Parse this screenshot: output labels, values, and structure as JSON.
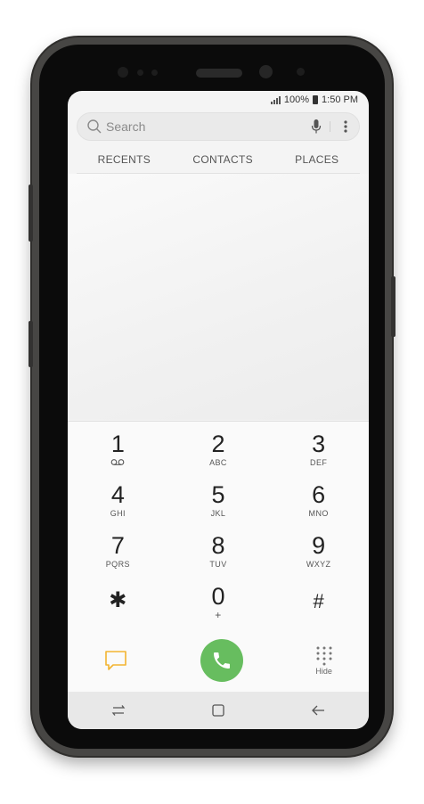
{
  "status_bar": {
    "battery": "100%",
    "time": "1:50 PM"
  },
  "search": {
    "placeholder": "Search"
  },
  "tabs": [
    {
      "label": "RECENTS"
    },
    {
      "label": "CONTACTS"
    },
    {
      "label": "PLACES"
    }
  ],
  "dialpad": {
    "keys": [
      {
        "digit": "1",
        "letters": ""
      },
      {
        "digit": "2",
        "letters": "ABC"
      },
      {
        "digit": "3",
        "letters": "DEF"
      },
      {
        "digit": "4",
        "letters": "GHI"
      },
      {
        "digit": "5",
        "letters": "JKL"
      },
      {
        "digit": "6",
        "letters": "MNO"
      },
      {
        "digit": "7",
        "letters": "PQRS"
      },
      {
        "digit": "8",
        "letters": "TUV"
      },
      {
        "digit": "9",
        "letters": "WXYZ"
      },
      {
        "digit": "✱",
        "letters": ""
      },
      {
        "digit": "0",
        "letters": "+"
      },
      {
        "digit": "#",
        "letters": ""
      }
    ],
    "hide_label": "Hide"
  },
  "colors": {
    "call_button": "#67bd5f",
    "message_icon": "#f3b431",
    "phone_body": "#474644"
  },
  "icons": {
    "search": "search-icon",
    "mic": "microphone-icon",
    "more": "more-vert-icon",
    "voicemail": "voicemail-icon",
    "message": "message-icon",
    "call": "phone-icon",
    "keypad": "keypad-icon",
    "recent_apps": "recent-apps-icon",
    "home": "home-icon",
    "back": "back-arrow-icon"
  }
}
